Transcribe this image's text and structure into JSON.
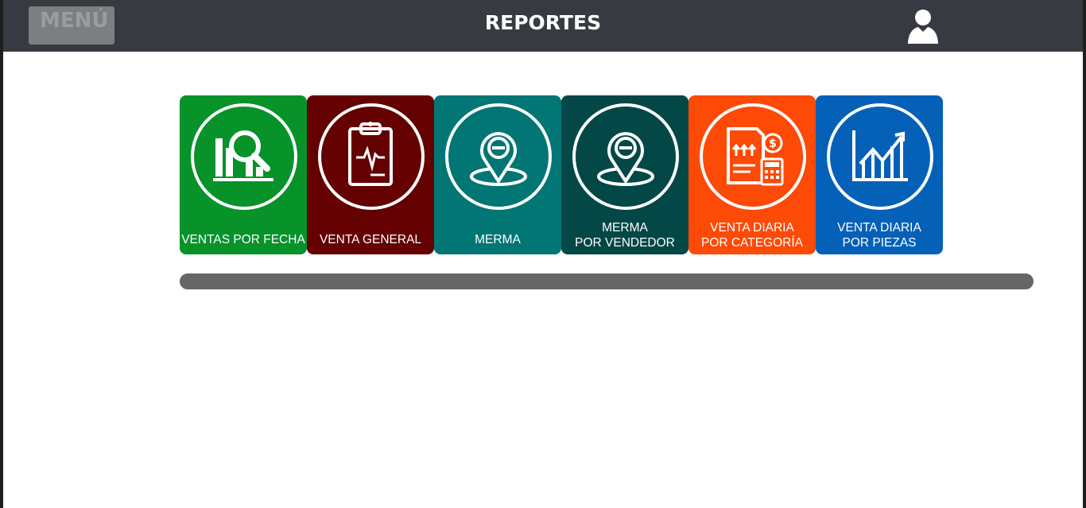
{
  "header": {
    "menu_label": "MENÚ",
    "title": "REPORTES",
    "user_icon": "user-icon"
  },
  "reports": [
    {
      "label1": "VENTAS POR FECHA",
      "label2": "",
      "color": "#07922a",
      "icon": "report-search-icon"
    },
    {
      "label1": "VENTA GENERAL",
      "label2": "",
      "color": "#640000",
      "icon": "clipboard-pulse-icon"
    },
    {
      "label1": "MERMA",
      "label2": "",
      "color": "#027575",
      "icon": "location-minus-icon"
    },
    {
      "label1": "MERMA",
      "label2": "POR VENDEDOR",
      "color": "#034747",
      "icon": "location-minus-icon"
    },
    {
      "label1": "VENTA DIARIA",
      "label2": "POR CATEGORÍA",
      "color": "#fd4a07",
      "icon": "invoice-calculator-icon"
    },
    {
      "label1": "VENTA DIARIA",
      "label2": "POR PIEZAS",
      "color": "#0561b8",
      "icon": "growth-chart-icon"
    }
  ]
}
